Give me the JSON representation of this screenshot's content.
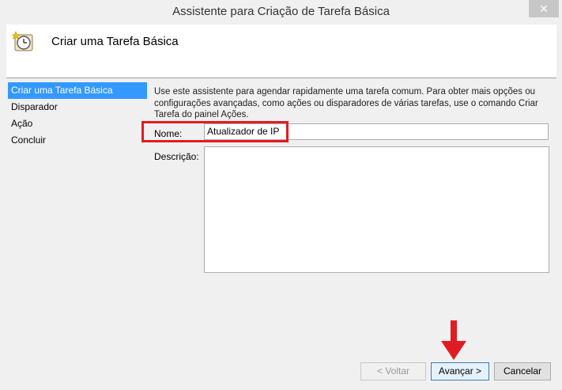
{
  "window": {
    "title": "Assistente para Criação de Tarefa Básica",
    "close_label": "✕"
  },
  "header": {
    "title": "Criar uma Tarefa Básica"
  },
  "sidebar": {
    "items": [
      {
        "label": "Criar uma Tarefa Básica",
        "active": true
      },
      {
        "label": "Disparador",
        "active": false
      },
      {
        "label": "Ação",
        "active": false
      },
      {
        "label": "Concluir",
        "active": false
      }
    ]
  },
  "main": {
    "intro": "Use este assistente para agendar rapidamente uma tarefa comum. Para obter mais opções ou configurações avançadas, como ações ou disparadores de várias tarefas, use o comando Criar Tarefa do painel Ações.",
    "name_label": "Nome:",
    "name_value": "Atualizador de IP",
    "description_label": "Descrição:",
    "description_value": ""
  },
  "buttons": {
    "back": "< Voltar",
    "next": "Avançar >",
    "cancel": "Cancelar"
  },
  "colors": {
    "annotation": "#e01c22",
    "selection": "#3399ff"
  },
  "icons": {
    "header": "scheduled-task-clock-icon",
    "arrow": "red-down-arrow-annotation"
  }
}
